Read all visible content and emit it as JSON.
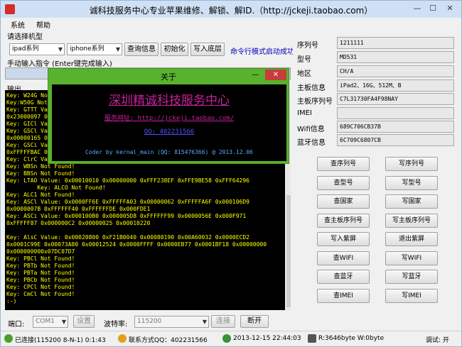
{
  "window": {
    "title": "诚科技服务中心专业苹果维修、解锁、解ID.（http://jckeji.taobao.com）",
    "min": "—",
    "max": "☐",
    "close": "✕"
  },
  "menu": {
    "system": "系统",
    "help": "帮助"
  },
  "model_select": {
    "label": "请选择机型",
    "series": "ipad系列",
    "model": "iphone系列",
    "query_btn": "查询信息",
    "init_btn": "初始化",
    "write_btn": "写入底层",
    "cmd_link": "命令行模式启动成功"
  },
  "manual": {
    "label": "手动输入指令 (Enter键完成输入)"
  },
  "output": {
    "label": "输出"
  },
  "console_lines": [
    "Key: W24G No",
    "Key:W50G Not",
    "Key: GTTT Va",
    "0x23000097 0",
    "Key: GICl Va",
    "Key: GSCl Va",
    "0x00000165 0",
    "Key: GSCi Va",
    "0xFFFFFBAC 0",
    "Key: ClrC Va",
    "Key: WBSn Not Found!",
    "Key: BBSn Not Found!",
    "Key: LTAO Value: 0x00010010 0x00000000 0xFFF238EF 0xFFE9BE58 0xFFF64296",
    "         Key: ALCO Not Found!",
    "Key: ALC1 Not Found!",
    "Key: ASCl Value: 0x0000FF6E 0xFFFFFA03 0x00000062 0xFFFFFA6F 0x000106D9",
    "0x0000007B 0xFFFFFF40 0xFFFFFFDE 0x000FDE1",
    "Key: ASCi Value: 0x000100B0 0x000005D8 0xFFFFFF99 0x0000056E 0x000F971",
    "0xFFFFF87 0x000000C2 0x00000025 0x00010220",
    "",
    "Key: AlsC Value: 0x00020800 0xF21B0040 0x00080190 0x00A60032 0x0000ECD2",
    "0x0001C99E 0x00073A80 0x00012524 0x0000FFFF 0x0000EB77 0x0001BF18 0x00000000",
    "0x000000000x07DC07D7",
    "Key: PBCl Not Found!",
    "Key: PBTb Not Found!",
    "Key: PBTa Not Found!",
    "Key: PBCb Not Found!",
    "Key: CPCl Not Found!",
    "Key: CmCl Not Found!",
    ":-)"
  ],
  "about": {
    "title": "关于",
    "min": "—",
    "close": "✕",
    "company": "深圳精诚科技服务中心",
    "shop": "服务网址: http://jckeji.taobao.com/",
    "qq": "QQ: 402231566",
    "coder": "Coder by kernal_main (QQ: 815476366) @ 2013.12.06"
  },
  "info": {
    "serial": {
      "label": "序列号",
      "value": "1211111"
    },
    "model": {
      "label": "型号",
      "value": "MD531"
    },
    "region": {
      "label": "地区",
      "value": "CH/A"
    },
    "board_info": {
      "label": "主板信息",
      "value": "iPad2、16G、512M、B"
    },
    "board_serial": {
      "label": "主板序列号",
      "value": "C7L31730FA4F98NAY"
    },
    "imei": {
      "label": "IMEI",
      "value": ""
    },
    "wifi": {
      "label": "Wifi信息",
      "value": "689C706CB37B"
    },
    "bt": {
      "label": "蓝牙信息",
      "value": "6C709C6807CB"
    }
  },
  "actions": [
    [
      "查序列号",
      "写序列号"
    ],
    [
      "查型号",
      "写型号"
    ],
    [
      "查国家",
      "写国家"
    ],
    [
      "查主板序列号",
      "写主板序列号"
    ],
    [
      "写入紫屏",
      "退出紫屏"
    ],
    [
      "查WIFI",
      "写WIFI"
    ],
    [
      "查蓝牙",
      "写蓝牙"
    ],
    [
      "查IMEI",
      "写IMEI"
    ]
  ],
  "port": {
    "port_label": "端口:",
    "port_value": "COM1",
    "settings_btn": "设置",
    "baud_label": "波特率:",
    "baud_value": "115200",
    "connect_btn": "连接",
    "disconnect_btn": "断开"
  },
  "status": {
    "connected": "已连接(115200 8-N-1) 0:1:43",
    "contact": "联系方式QQ：402231566",
    "datetime": "2013-12-15 22:44:03",
    "rw": "R:3646byte W:0byte",
    "debug": "调试: 开"
  },
  "colors": {
    "console_text": "#ffff00",
    "about_bg": "#59b22e",
    "company": "#c8209c",
    "link": "#5050ff"
  }
}
